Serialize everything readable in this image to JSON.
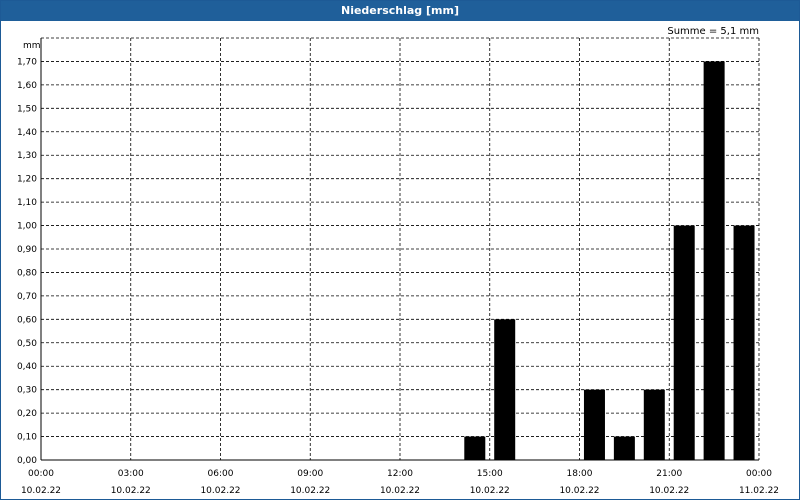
{
  "window": {
    "title": "Niederschlag [mm]"
  },
  "summary": "Summe = 5,1 mm",
  "chart_data": {
    "type": "bar",
    "title": "Niederschlag [mm]",
    "ylabel": "mm",
    "xlabel": "",
    "ylim": [
      0,
      1.8
    ],
    "yticks": [
      "0,00",
      "0,10",
      "0,20",
      "0,30",
      "0,40",
      "0,50",
      "0,60",
      "0,70",
      "0,80",
      "0,90",
      "1,00",
      "1,10",
      "1,20",
      "1,30",
      "1,40",
      "1,50",
      "1,60",
      "1,70"
    ],
    "xlim_hours": [
      0,
      24
    ],
    "xticks": [
      {
        "time": "00:00",
        "date": "10.02.22"
      },
      {
        "time": "03:00",
        "date": "10.02.22"
      },
      {
        "time": "06:00",
        "date": "10.02.22"
      },
      {
        "time": "09:00",
        "date": "10.02.22"
      },
      {
        "time": "12:00",
        "date": "10.02.22"
      },
      {
        "time": "15:00",
        "date": "10.02.22"
      },
      {
        "time": "18:00",
        "date": "10.02.22"
      },
      {
        "time": "21:00",
        "date": "10.02.22"
      },
      {
        "time": "00:00",
        "date": "11.02.22"
      }
    ],
    "grid": true,
    "bar_color": "#000000",
    "series": [
      {
        "values": [
          {
            "hour": 14.5,
            "value": 0.1
          },
          {
            "hour": 15.5,
            "value": 0.6
          },
          {
            "hour": 18.5,
            "value": 0.3
          },
          {
            "hour": 19.5,
            "value": 0.1
          },
          {
            "hour": 20.5,
            "value": 0.3
          },
          {
            "hour": 21.5,
            "value": 1.0
          },
          {
            "hour": 22.5,
            "value": 1.7
          },
          {
            "hour": 23.5,
            "value": 1.0
          }
        ]
      }
    ]
  }
}
